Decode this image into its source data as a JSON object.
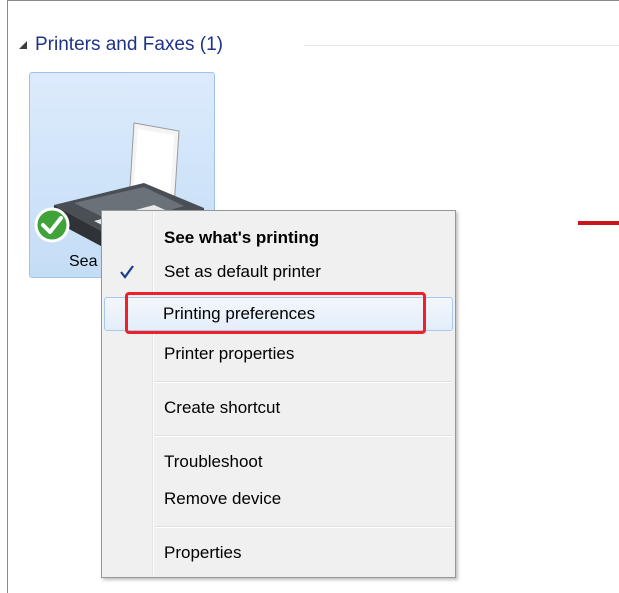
{
  "group": {
    "title": "Printers and Faxes (1)",
    "icon": "collapse-triangle-icon"
  },
  "device": {
    "label_visible": "Sea",
    "icon": "printer-icon",
    "status_icon": "default-check-badge-icon"
  },
  "context_menu": {
    "items": [
      {
        "label": "See what's printing",
        "bold": true
      },
      {
        "label": "Set as default printer",
        "checked": true
      },
      {
        "label": "Printing preferences",
        "highlighted": true
      },
      {
        "label": "Printer properties"
      },
      {
        "label": "Create shortcut"
      },
      {
        "label": "Troubleshoot"
      },
      {
        "label": "Remove device"
      },
      {
        "label": "Properties"
      }
    ]
  },
  "colors": {
    "group_title": "#1e3287",
    "highlight_box": "#f0202a",
    "red_line": "#c8161d",
    "tile_bg": "#cfe3f8"
  }
}
